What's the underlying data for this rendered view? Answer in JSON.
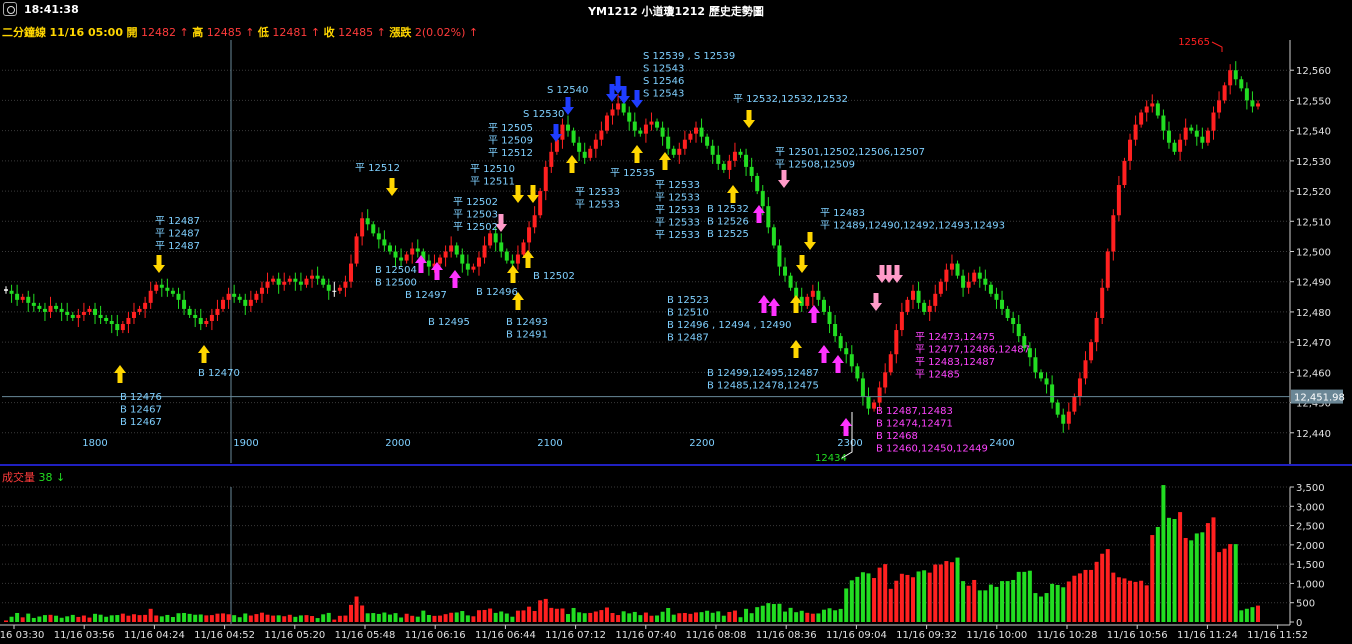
{
  "header": {
    "time": "18:41:38",
    "title": "YM1212 小道瓊1212  歷史走勢圖"
  },
  "quote": {
    "period": "二分鐘線",
    "datetime": "11/16 05:00",
    "open_label": "開",
    "open": "12482",
    "high_label": "高",
    "high": "12485",
    "low_label": "低",
    "low": "12481",
    "close_label": "收",
    "close": "12485",
    "change_label": "漲跌",
    "change": "2(0.02%)",
    "up_arrow": "↑"
  },
  "volume_header": {
    "label": "成交量",
    "value": "38",
    "arrow": "↓"
  },
  "colors": {
    "up": "#ff2020",
    "down": "#22dd22",
    "flat": "#ffffff",
    "axis": "#2020c0",
    "grid": "#3a3a3a",
    "text": "#7fd0ff",
    "buy": "#ffd600",
    "sell": "#1f3dff",
    "magenta": "#ff33ff",
    "pink": "#ff9ac8"
  },
  "chart_data": [
    {
      "type": "candlestick",
      "panel": "price",
      "ylim": [
        12430,
        12570
      ],
      "yticks": [
        "12,440",
        "12,450",
        "12,460",
        "12,470",
        "12,480",
        "12,490",
        "12,500",
        "12,510",
        "12,520",
        "12,530",
        "12,540",
        "12,550",
        "12,560"
      ],
      "cursor_value": "12,451.98",
      "grid": true,
      "period_markers": [
        "1800",
        "1900",
        "2000",
        "2100",
        "2200",
        "2300",
        "2400"
      ],
      "high_label": "12565",
      "low_label": "12434",
      "closes": [
        12487,
        12486,
        12484,
        12485,
        12483,
        12482,
        12481,
        12480,
        12482,
        12481,
        12480,
        12479,
        12478,
        12479,
        12480,
        12481,
        12479,
        12478,
        12477,
        12476,
        12474,
        12476,
        12478,
        12480,
        12481,
        12483,
        12487,
        12489,
        12488,
        12487,
        12486,
        12484,
        12481,
        12479,
        12478,
        12476,
        12477,
        12479,
        12481,
        12484,
        12486,
        12485,
        12484,
        12482,
        12484,
        12486,
        12488,
        12490,
        12491,
        12489,
        12490,
        12491,
        12490,
        12489,
        12491,
        12492,
        12491,
        12489,
        12487,
        12487,
        12488,
        12490,
        12496,
        12505,
        12511,
        12509,
        12506,
        12504,
        12502,
        12500,
        12498,
        12497,
        12499,
        12501,
        12500,
        12497,
        12495,
        12496,
        12498,
        12500,
        12502,
        12499,
        12496,
        12494,
        12495,
        12498,
        12502,
        12506,
        12503,
        12500,
        12497,
        12496,
        12499,
        12503,
        12508,
        12512,
        12520,
        12528,
        12533,
        12537,
        12542,
        12540,
        12536,
        12533,
        12531,
        12534,
        12537,
        12540,
        12545,
        12547,
        12549,
        12546,
        12543,
        12540,
        12539,
        12542,
        12543,
        12541,
        12538,
        12534,
        12532,
        12534,
        12537,
        12539,
        12541,
        12538,
        12535,
        12532,
        12529,
        12527,
        12530,
        12533,
        12532,
        12528,
        12525,
        12520,
        12515,
        12508,
        12502,
        12495,
        12492,
        12488,
        12485,
        12482,
        12485,
        12487,
        12484,
        12480,
        12476,
        12472,
        12468,
        12466,
        12462,
        12458,
        12452,
        12448,
        12450,
        12455,
        12460,
        12466,
        12474,
        12480,
        12484,
        12487,
        12483,
        12480,
        12482,
        12486,
        12490,
        12494,
        12496,
        12492,
        12488,
        12490,
        12493,
        12491,
        12489,
        12486,
        12484,
        12481,
        12478,
        12476,
        12472,
        12468,
        12465,
        12460,
        12458,
        12456,
        12450,
        12446,
        12443,
        12447,
        12452,
        12458,
        12464,
        12470,
        12478,
        12488,
        12500,
        12512,
        12522,
        12530,
        12537,
        12542,
        12546,
        12548,
        12549,
        12545,
        12540,
        12536,
        12533,
        12537,
        12541,
        12540,
        12538,
        12536,
        12540,
        12546,
        12550,
        12555,
        12560,
        12557,
        12554,
        12550,
        12548,
        12549
      ]
    },
    {
      "type": "bar",
      "panel": "volume",
      "ylim": [
        0,
        3500
      ],
      "yticks": [
        "0",
        "500",
        "1,000",
        "1,500",
        "2,000",
        "2,500",
        "3,000",
        "3,500"
      ],
      "x_labels": [
        "11/16 03:30",
        "11/16 03:56",
        "11/16 04:24",
        "11/16 04:52",
        "11/16 05:20",
        "11/16 05:48",
        "11/16 06:16",
        "11/16 06:44",
        "11/16 07:12",
        "11/16 07:40",
        "11/16 08:08",
        "11/16 08:36",
        "11/16 09:04",
        "11/16 09:32",
        "11/16 10:00",
        "11/16 10:28",
        "11/16 10:56",
        "11/16 11:24",
        "11/16 11:52"
      ]
    }
  ],
  "annotations": [
    {
      "text": "B 12476\nB 12467\nB 12467",
      "color": "text"
    },
    {
      "text": "平 12487\n平 12487\n平 12487",
      "color": "text"
    },
    {
      "text": "B 12470",
      "color": "text"
    },
    {
      "text": "平 12512",
      "color": "text"
    },
    {
      "text": "B 12504\nB 12500",
      "color": "text"
    },
    {
      "text": "B 12497",
      "color": "text"
    },
    {
      "text": "B 12495",
      "color": "text"
    },
    {
      "text": "平 12502\n平 12503\n平 12502",
      "color": "text"
    },
    {
      "text": "平 12510\n平 12511",
      "color": "text"
    },
    {
      "text": "平 12505\n平 12509\n平 12512",
      "color": "text"
    },
    {
      "text": "B 12496",
      "color": "text"
    },
    {
      "text": "B 12502",
      "color": "text"
    },
    {
      "text": "B 12493\nB 12491",
      "color": "text"
    },
    {
      "text": "S 12530",
      "color": "text"
    },
    {
      "text": "S 12540",
      "color": "text"
    },
    {
      "text": "S 12539 , S 12539\nS 12543\nS 12546\nS 12543",
      "color": "text"
    },
    {
      "text": "平 12533\n平 12533",
      "color": "text"
    },
    {
      "text": "平 12535",
      "color": "text"
    },
    {
      "text": "平 12533\n平 12533\n平 12533\n平 12533\n平 12533",
      "color": "text"
    },
    {
      "text": "平 12532,12532,12532",
      "color": "text"
    },
    {
      "text": "B 12532\nB 12526\nB 12525",
      "color": "text"
    },
    {
      "text": "平 12501,12502,12506,12507\n平 12508,12509",
      "color": "text"
    },
    {
      "text": "平 12483\n平 12489,12490,12492,12493,12493",
      "color": "text"
    },
    {
      "text": "B 12523\nB 12510\nB 12496 , 12494 , 12490\nB 12487",
      "color": "text"
    },
    {
      "text": "B 12499,12495,12487\nB 12485,12478,12475",
      "color": "text"
    },
    {
      "text": "平 12473,12475\n平 12477,12486,12487\n平 12483,12487\n平 12485",
      "color": "magenta"
    },
    {
      "text": "B 12487,12483\nB 12474,12471\nB 12468\nB 12460,12450,12449",
      "color": "magenta"
    }
  ]
}
